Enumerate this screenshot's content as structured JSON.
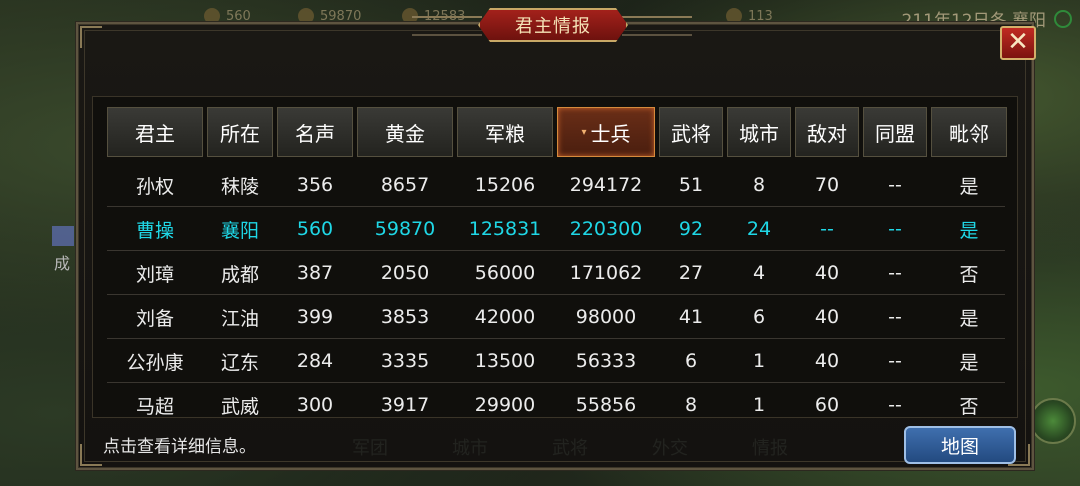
{
  "top_bar": {
    "items": [
      "560",
      "59870",
      "12583",
      "113"
    ],
    "date": "211年12日冬 襄阳"
  },
  "side": {
    "city_label": "成"
  },
  "dialog": {
    "title": "君主情报",
    "close_glyph": "✕",
    "hint": "点击查看详细信息。",
    "map_button": "地图",
    "ghost_tabs": [
      "军团",
      "城市",
      "武将",
      "外交",
      "情报"
    ]
  },
  "table": {
    "sort_indicator": "▾",
    "columns": [
      "君主",
      "所在",
      "名声",
      "黄金",
      "军粮",
      "士兵",
      "武将",
      "城市",
      "敌对",
      "同盟",
      "毗邻"
    ],
    "sorted_column": "士兵",
    "rows": [
      [
        "孙权",
        "秣陵",
        "356",
        "8657",
        "15206",
        "294172",
        "51",
        "8",
        "70",
        "--",
        "是"
      ],
      [
        "曹操",
        "襄阳",
        "560",
        "59870",
        "125831",
        "220300",
        "92",
        "24",
        "--",
        "--",
        "是"
      ],
      [
        "刘璋",
        "成都",
        "387",
        "2050",
        "56000",
        "171062",
        "27",
        "4",
        "40",
        "--",
        "否"
      ],
      [
        "刘备",
        "江油",
        "399",
        "3853",
        "42000",
        "98000",
        "41",
        "6",
        "40",
        "--",
        "是"
      ],
      [
        "公孙康",
        "辽东",
        "284",
        "3335",
        "13500",
        "56333",
        "6",
        "1",
        "40",
        "--",
        "是"
      ],
      [
        "马超",
        "武威",
        "300",
        "3917",
        "29900",
        "55856",
        "8",
        "1",
        "60",
        "--",
        "否"
      ]
    ],
    "highlight_row": 1
  },
  "colors": {
    "self_row": "#1fd7e6",
    "title_plate": "#a3211b",
    "map_button": "#3f6fae"
  }
}
